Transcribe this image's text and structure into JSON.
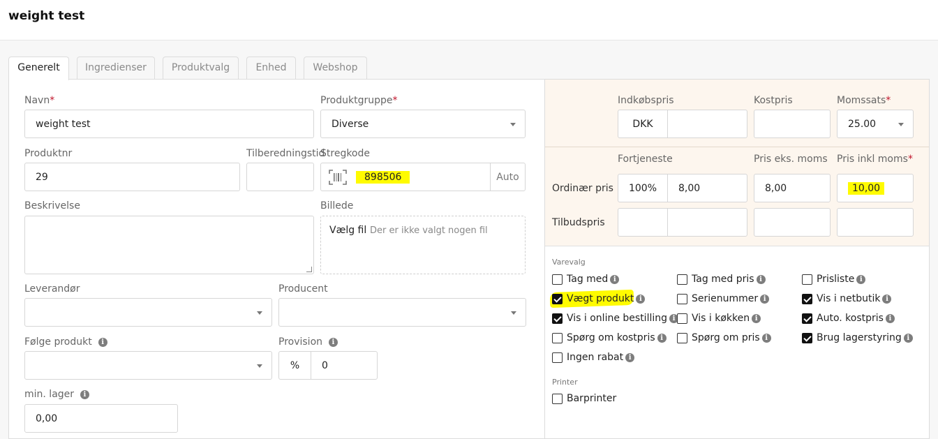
{
  "page": {
    "title": "weight test"
  },
  "tabs": [
    {
      "label": "Generelt",
      "active": true
    },
    {
      "label": "Ingredienser"
    },
    {
      "label": "Produktvalg"
    },
    {
      "label": "Enhed"
    },
    {
      "label": "Webshop"
    }
  ],
  "form": {
    "navn": {
      "label": "Navn",
      "value": "weight test"
    },
    "produktgruppe": {
      "label": "Produktgruppe",
      "value": "Diverse"
    },
    "produktnr": {
      "label": "Produktnr",
      "value": "29"
    },
    "tilberedningstid": {
      "label": "Tilberedningstid",
      "value": ""
    },
    "stregkode": {
      "label": "Stregkode",
      "value": "898506",
      "auto": "Auto"
    },
    "beskrivelse": {
      "label": "Beskrivelse",
      "value": ""
    },
    "billede": {
      "label": "Billede",
      "button": "Vælg fil",
      "status": "Der er ikke valgt nogen fil"
    },
    "leverandor": {
      "label": "Leverandør",
      "value": ""
    },
    "producent": {
      "label": "Producent",
      "value": ""
    },
    "folge_produkt": {
      "label": "Følge produkt",
      "value": ""
    },
    "provision": {
      "label": "Provision",
      "unit": "%",
      "value": "0"
    },
    "min_lager": {
      "label": "min. lager",
      "value": "0,00"
    },
    "required_mark": "*"
  },
  "pricing": {
    "indkobspris": {
      "label": "Indkøbspris",
      "currency": "DKK",
      "value": ""
    },
    "kostpris": {
      "label": "Kostpris",
      "value": ""
    },
    "momssats": {
      "label": "Momssats",
      "value": "25.00"
    },
    "fortjeneste": {
      "label": "Fortjeneste"
    },
    "pris_eks_moms": {
      "label": "Pris eks. moms"
    },
    "pris_inkl_moms": {
      "label": "Pris inkl moms"
    },
    "ordinaer": {
      "label": "Ordinær pris",
      "percent": "100%",
      "fortjeneste": "8,00",
      "eks_moms": "8,00",
      "inkl_moms": "10,00"
    },
    "tilbud": {
      "label": "Tilbudspris",
      "percent": "",
      "fortjeneste": "",
      "eks_moms": "",
      "inkl_moms": ""
    }
  },
  "varevalg": {
    "title": "Varevalg",
    "options": [
      {
        "label": "Tag med",
        "checked": false
      },
      {
        "label": "Tag med pris",
        "checked": false
      },
      {
        "label": "Prisliste",
        "checked": false
      },
      {
        "label": "Vægt produkt",
        "checked": true
      },
      {
        "label": "Serienummer",
        "checked": false
      },
      {
        "label": "Vis i netbutik",
        "checked": true
      },
      {
        "label": "Vis i online bestilling",
        "checked": true
      },
      {
        "label": "Vis i køkken",
        "checked": false
      },
      {
        "label": "Auto. kostpris",
        "checked": true
      },
      {
        "label": "Spørg om kostpris",
        "checked": false
      },
      {
        "label": "Spørg om pris",
        "checked": false
      },
      {
        "label": "Brug lagerstyring",
        "checked": true
      },
      {
        "label": "Ingen rabat",
        "checked": false
      }
    ]
  },
  "printer": {
    "title": "Printer",
    "options": [
      {
        "label": "Barprinter",
        "checked": false
      }
    ]
  },
  "colors": {
    "highlight": "#fffb00",
    "required": "#c0152b",
    "price_bg": "#fdf6ee"
  },
  "icons": {
    "info": "info-icon",
    "barcode": "barcode-icon",
    "dropdown": "chevron-down-icon"
  }
}
